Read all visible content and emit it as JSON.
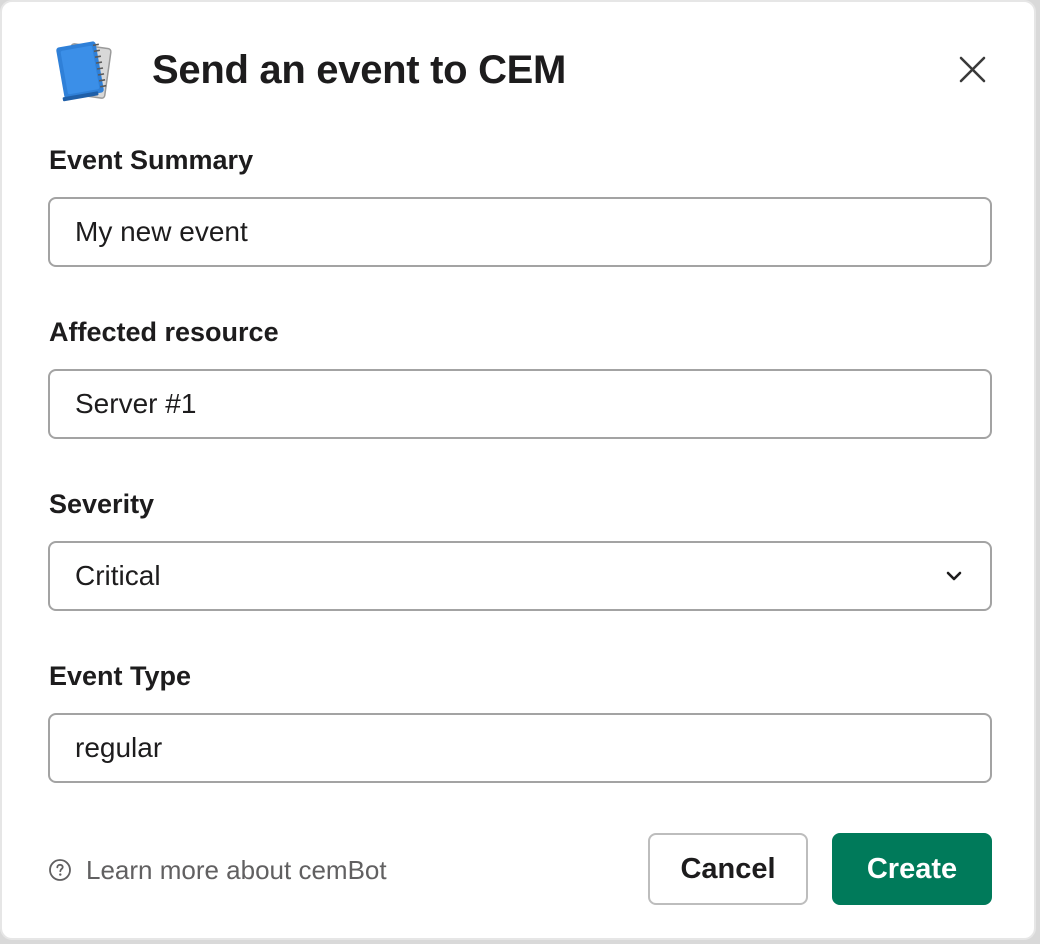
{
  "modal": {
    "title": "Send an event to CEM",
    "app_icon": "notebook-icon",
    "close_icon": "close-icon"
  },
  "fields": {
    "event_summary": {
      "label": "Event Summary",
      "value": "My new event"
    },
    "affected_resource": {
      "label": "Affected resource",
      "value": "Server #1"
    },
    "severity": {
      "label": "Severity",
      "selected": "Critical",
      "icon": "chevron-down-icon"
    },
    "event_type": {
      "label": "Event Type",
      "value": "regular"
    }
  },
  "footer": {
    "help_icon": "question-circle-icon",
    "help_text": "Learn more about cemBot",
    "cancel_label": "Cancel",
    "create_label": "Create"
  },
  "colors": {
    "primary_button": "#007a5a",
    "text": "#1d1c1d",
    "muted_text": "#616061",
    "input_border": "#a3a3a3"
  }
}
